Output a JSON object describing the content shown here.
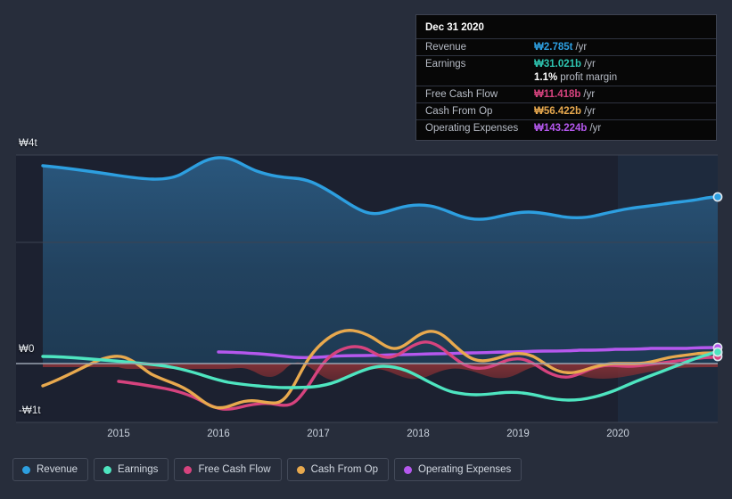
{
  "axes": {
    "y_ticks": [
      {
        "label": "₩4t",
        "value": 4000
      },
      {
        "label": "₩0",
        "value": 0
      },
      {
        "label": "-₩1t",
        "value": -1000
      }
    ],
    "x_ticks": [
      "2015",
      "2016",
      "2017",
      "2018",
      "2019",
      "2020"
    ]
  },
  "tooltip": {
    "title": "Dec 31 2020",
    "rows": [
      {
        "label": "Revenue",
        "value": "₩2.785t",
        "unit": "/yr",
        "color": "#2d9fe0"
      },
      {
        "label": "Earnings",
        "value": "₩31.021b",
        "unit": "/yr",
        "color": "#2ec4b0"
      },
      {
        "label": "Free Cash Flow",
        "value": "₩11.418b",
        "unit": "/yr",
        "color": "#d6437e"
      },
      {
        "label": "Cash From Op",
        "value": "₩56.422b",
        "unit": "/yr",
        "color": "#e8a94e"
      },
      {
        "label": "Operating Expenses",
        "value": "₩143.224b",
        "unit": "/yr",
        "color": "#b558ee"
      }
    ],
    "profit_margin": {
      "value": "1.1%",
      "label": "profit margin"
    }
  },
  "legend": {
    "items": [
      {
        "label": "Revenue",
        "color": "#2d9fe0"
      },
      {
        "label": "Earnings",
        "color": "#4ee5c0"
      },
      {
        "label": "Free Cash Flow",
        "color": "#d6437e"
      },
      {
        "label": "Cash From Op",
        "color": "#e8a94e"
      },
      {
        "label": "Operating Expenses",
        "color": "#b558ee"
      }
    ]
  },
  "colors": {
    "page_background": "#272d3b",
    "plot_background": "#1c2130",
    "plot_background_right": "#1d2739",
    "gridline": "#39404f",
    "zero_line": "#9aa3b0",
    "revenue_fill": "#21415e",
    "negative_fill": "#7d2f34"
  },
  "chart_data": {
    "type": "area",
    "title": "",
    "xlabel": "",
    "ylabel": "",
    "currency": "KRW",
    "xlim": [
      "2014-07",
      "2020-12"
    ],
    "ylim": [
      -1150,
      4600
    ],
    "grid": true,
    "legend_position": "bottom",
    "y_unit": "billions KRW",
    "x": [
      2014.55,
      2014.8,
      2015.05,
      2015.3,
      2015.55,
      2015.8,
      2016.05,
      2016.3,
      2016.55,
      2016.8,
      2017.05,
      2017.3,
      2017.55,
      2017.8,
      2018.05,
      2018.3,
      2018.55,
      2018.8,
      2019.05,
      2019.3,
      2019.55,
      2019.8,
      2020.05,
      2020.3,
      2020.55,
      2020.95
    ],
    "series": [
      {
        "name": "Revenue",
        "color": "#2d9fe0",
        "filled": true,
        "values": [
          3780,
          3720,
          3640,
          3600,
          3640,
          3830,
          3970,
          3880,
          3800,
          3790,
          3700,
          3500,
          3400,
          3370,
          3310,
          3250,
          3170,
          3060,
          3020,
          3060,
          3080,
          3000,
          3010,
          3060,
          3120,
          3230
        ],
        "end_value": 2785,
        "end_label": "₩2.785t"
      },
      {
        "name": "Earnings",
        "color": "#4ee5c0",
        "filled": false,
        "values": [
          150,
          130,
          100,
          50,
          -20,
          -60,
          -70,
          -100,
          -180,
          -300,
          -340,
          -340,
          -330,
          -320,
          -310,
          -300,
          -290,
          -110,
          -60,
          -230,
          -310,
          -350,
          -380,
          -350,
          -290,
          -30
        ],
        "end_value": 31.021,
        "end_label": "₩31.021b"
      },
      {
        "name": "Free Cash Flow",
        "color": "#d6437e",
        "filled": false,
        "values": [
          null,
          null,
          -300,
          -380,
          -480,
          -680,
          -760,
          -770,
          -230,
          60,
          300,
          420,
          140,
          290,
          190,
          130,
          60,
          -20,
          -170,
          -120,
          -130,
          40,
          -110,
          -150,
          -100,
          -20
        ],
        "end_value": 11.418,
        "end_label": "₩11.418b"
      },
      {
        "name": "Cash From Op",
        "color": "#e8a94e",
        "filled": false,
        "values": [
          -640,
          -420,
          -200,
          -60,
          -200,
          -330,
          -420,
          -700,
          -790,
          -220,
          120,
          380,
          470,
          180,
          330,
          250,
          160,
          -10,
          -160,
          -110,
          -120,
          60,
          -100,
          -140,
          -80,
          20
        ],
        "end_value": 56.422,
        "end_label": "₩56.422b"
      },
      {
        "name": "Operating Expenses",
        "color": "#b558ee",
        "filled": false,
        "values": [
          null,
          null,
          null,
          null,
          null,
          null,
          110,
          105,
          100,
          95,
          95,
          100,
          110,
          115,
          120,
          125,
          125,
          125,
          125,
          130,
          130,
          135,
          135,
          140,
          140,
          143
        ],
        "end_value": 143.224,
        "end_label": "₩143.224b"
      }
    ]
  }
}
